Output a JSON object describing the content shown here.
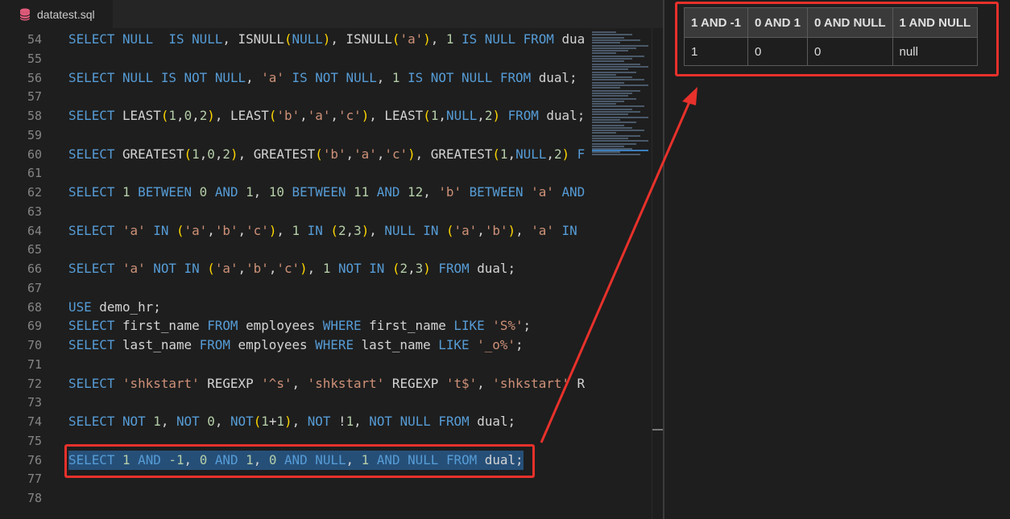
{
  "tab": {
    "title": "datatest.sql",
    "icon": "database-icon"
  },
  "editor": {
    "lines": [
      {
        "n": "54",
        "t": [
          [
            "kw",
            "SELECT "
          ],
          [
            "kw",
            "NULL"
          ],
          [
            "",
            "  "
          ],
          [
            "kw",
            "IS "
          ],
          [
            "kw",
            "NULL"
          ],
          [
            "",
            ", ISNULL"
          ],
          [
            "par",
            "("
          ],
          [
            "kw",
            "NULL"
          ],
          [
            "par",
            ")"
          ],
          [
            "",
            ", ISNULL"
          ],
          [
            "par",
            "("
          ],
          [
            "str",
            "'a'"
          ],
          [
            "par",
            ")"
          ],
          [
            "",
            ", "
          ],
          [
            "num",
            "1 "
          ],
          [
            "kw",
            "IS "
          ],
          [
            "kw",
            "NULL "
          ],
          [
            "kw",
            "FROM "
          ],
          [
            "",
            "dual"
          ]
        ]
      },
      {
        "n": "55",
        "t": []
      },
      {
        "n": "56",
        "t": [
          [
            "kw",
            "SELECT "
          ],
          [
            "kw",
            "NULL "
          ],
          [
            "kw",
            "IS "
          ],
          [
            "kw",
            "NOT "
          ],
          [
            "kw",
            "NULL"
          ],
          [
            "",
            ", "
          ],
          [
            "str",
            "'a' "
          ],
          [
            "kw",
            "IS "
          ],
          [
            "kw",
            "NOT "
          ],
          [
            "kw",
            "NULL"
          ],
          [
            "",
            ", "
          ],
          [
            "num",
            "1 "
          ],
          [
            "kw",
            "IS "
          ],
          [
            "kw",
            "NOT "
          ],
          [
            "kw",
            "NULL "
          ],
          [
            "kw",
            "FROM "
          ],
          [
            "",
            "dual;"
          ]
        ]
      },
      {
        "n": "57",
        "t": []
      },
      {
        "n": "58",
        "t": [
          [
            "kw",
            "SELECT "
          ],
          [
            "",
            "LEAST"
          ],
          [
            "par",
            "("
          ],
          [
            "num",
            "1"
          ],
          [
            "",
            ","
          ],
          [
            "num",
            "0"
          ],
          [
            "",
            ","
          ],
          [
            "num",
            "2"
          ],
          [
            "par",
            ")"
          ],
          [
            "",
            ", LEAST"
          ],
          [
            "par",
            "("
          ],
          [
            "str",
            "'b'"
          ],
          [
            "",
            ","
          ],
          [
            "str",
            "'a'"
          ],
          [
            "",
            ","
          ],
          [
            "str",
            "'c'"
          ],
          [
            "par",
            ")"
          ],
          [
            "",
            ", LEAST"
          ],
          [
            "par",
            "("
          ],
          [
            "num",
            "1"
          ],
          [
            "",
            ","
          ],
          [
            "kw",
            "NULL"
          ],
          [
            "",
            ","
          ],
          [
            "num",
            "2"
          ],
          [
            "par",
            ")"
          ],
          [
            "kw",
            " FROM "
          ],
          [
            "",
            "dual;"
          ]
        ]
      },
      {
        "n": "59",
        "t": []
      },
      {
        "n": "60",
        "t": [
          [
            "kw",
            "SELECT "
          ],
          [
            "",
            "GREATEST"
          ],
          [
            "par",
            "("
          ],
          [
            "num",
            "1"
          ],
          [
            "",
            ","
          ],
          [
            "num",
            "0"
          ],
          [
            "",
            ","
          ],
          [
            "num",
            "2"
          ],
          [
            "par",
            ")"
          ],
          [
            "",
            ", GREATEST"
          ],
          [
            "par",
            "("
          ],
          [
            "str",
            "'b'"
          ],
          [
            "",
            ","
          ],
          [
            "str",
            "'a'"
          ],
          [
            "",
            ","
          ],
          [
            "str",
            "'c'"
          ],
          [
            "par",
            ")"
          ],
          [
            "",
            ", GREATEST"
          ],
          [
            "par",
            "("
          ],
          [
            "num",
            "1"
          ],
          [
            "",
            ","
          ],
          [
            "kw",
            "NULL"
          ],
          [
            "",
            ","
          ],
          [
            "num",
            "2"
          ],
          [
            "par",
            ")"
          ],
          [
            "kw",
            " F"
          ]
        ]
      },
      {
        "n": "61",
        "t": []
      },
      {
        "n": "62",
        "t": [
          [
            "kw",
            "SELECT "
          ],
          [
            "num",
            "1 "
          ],
          [
            "kw",
            "BETWEEN "
          ],
          [
            "num",
            "0 "
          ],
          [
            "kw",
            "AND "
          ],
          [
            "num",
            "1"
          ],
          [
            "",
            ", "
          ],
          [
            "num",
            "10 "
          ],
          [
            "kw",
            "BETWEEN "
          ],
          [
            "num",
            "11 "
          ],
          [
            "kw",
            "AND "
          ],
          [
            "num",
            "12"
          ],
          [
            "",
            ", "
          ],
          [
            "str",
            "'b' "
          ],
          [
            "kw",
            "BETWEEN "
          ],
          [
            "str",
            "'a' "
          ],
          [
            "kw",
            "AND"
          ]
        ]
      },
      {
        "n": "63",
        "t": []
      },
      {
        "n": "64",
        "t": [
          [
            "kw",
            "SELECT "
          ],
          [
            "str",
            "'a' "
          ],
          [
            "kw",
            "IN "
          ],
          [
            "par",
            "("
          ],
          [
            "str",
            "'a'"
          ],
          [
            "",
            ","
          ],
          [
            "str",
            "'b'"
          ],
          [
            "",
            ","
          ],
          [
            "str",
            "'c'"
          ],
          [
            "par",
            ")"
          ],
          [
            "",
            ", "
          ],
          [
            "num",
            "1 "
          ],
          [
            "kw",
            "IN "
          ],
          [
            "par",
            "("
          ],
          [
            "num",
            "2"
          ],
          [
            "",
            ","
          ],
          [
            "num",
            "3"
          ],
          [
            "par",
            ")"
          ],
          [
            "",
            ", "
          ],
          [
            "kw",
            "NULL "
          ],
          [
            "kw",
            "IN "
          ],
          [
            "par",
            "("
          ],
          [
            "str",
            "'a'"
          ],
          [
            "",
            ","
          ],
          [
            "str",
            "'b'"
          ],
          [
            "par",
            ")"
          ],
          [
            "",
            ", "
          ],
          [
            "str",
            "'a' "
          ],
          [
            "kw",
            "IN"
          ]
        ]
      },
      {
        "n": "65",
        "t": []
      },
      {
        "n": "66",
        "t": [
          [
            "kw",
            "SELECT "
          ],
          [
            "str",
            "'a' "
          ],
          [
            "kw",
            "NOT "
          ],
          [
            "kw",
            "IN "
          ],
          [
            "par",
            "("
          ],
          [
            "str",
            "'a'"
          ],
          [
            "",
            ","
          ],
          [
            "str",
            "'b'"
          ],
          [
            "",
            ","
          ],
          [
            "str",
            "'c'"
          ],
          [
            "par",
            ")"
          ],
          [
            "",
            ", "
          ],
          [
            "num",
            "1 "
          ],
          [
            "kw",
            "NOT "
          ],
          [
            "kw",
            "IN "
          ],
          [
            "par",
            "("
          ],
          [
            "num",
            "2"
          ],
          [
            "",
            ","
          ],
          [
            "num",
            "3"
          ],
          [
            "par",
            ")"
          ],
          [
            "kw",
            " FROM "
          ],
          [
            "",
            "dual;"
          ]
        ]
      },
      {
        "n": "67",
        "t": []
      },
      {
        "n": "68",
        "t": [
          [
            "kw",
            "USE "
          ],
          [
            "",
            "demo_hr;"
          ]
        ]
      },
      {
        "n": "69",
        "t": [
          [
            "kw",
            "SELECT "
          ],
          [
            "",
            "first_name "
          ],
          [
            "kw",
            "FROM "
          ],
          [
            "",
            "employees "
          ],
          [
            "kw",
            "WHERE "
          ],
          [
            "",
            "first_name "
          ],
          [
            "kw",
            "LIKE "
          ],
          [
            "str",
            "'S%'"
          ],
          [
            "",
            ";"
          ]
        ]
      },
      {
        "n": "70",
        "t": [
          [
            "kw",
            "SELECT "
          ],
          [
            "",
            "last_name "
          ],
          [
            "kw",
            "FROM "
          ],
          [
            "",
            "employees "
          ],
          [
            "kw",
            "WHERE "
          ],
          [
            "",
            "last_name "
          ],
          [
            "kw",
            "LIKE "
          ],
          [
            "str",
            "'_o%'"
          ],
          [
            "",
            ";"
          ]
        ]
      },
      {
        "n": "71",
        "t": []
      },
      {
        "n": "72",
        "t": [
          [
            "kw",
            "SELECT "
          ],
          [
            "str",
            "'shkstart' "
          ],
          [
            "",
            "REGEXP "
          ],
          [
            "str",
            "'^s'"
          ],
          [
            "",
            ", "
          ],
          [
            "str",
            "'shkstart' "
          ],
          [
            "",
            "REGEXP "
          ],
          [
            "str",
            "'t$'"
          ],
          [
            "",
            ", "
          ],
          [
            "str",
            "'shkstart' "
          ],
          [
            "",
            "R"
          ]
        ]
      },
      {
        "n": "73",
        "t": []
      },
      {
        "n": "74",
        "t": [
          [
            "kw",
            "SELECT "
          ],
          [
            "kw",
            "NOT "
          ],
          [
            "num",
            "1"
          ],
          [
            "",
            ", "
          ],
          [
            "kw",
            "NOT "
          ],
          [
            "num",
            "0"
          ],
          [
            "",
            ", "
          ],
          [
            "kw",
            "NOT"
          ],
          [
            "par",
            "("
          ],
          [
            "num",
            "1"
          ],
          [
            "",
            "+"
          ],
          [
            "num",
            "1"
          ],
          [
            "par",
            ")"
          ],
          [
            "",
            ", "
          ],
          [
            "kw",
            "NOT "
          ],
          [
            "",
            "!"
          ],
          [
            "num",
            "1"
          ],
          [
            "",
            ", "
          ],
          [
            "kw",
            "NOT "
          ],
          [
            "kw",
            "NULL "
          ],
          [
            "kw",
            "FROM "
          ],
          [
            "",
            "dual;"
          ]
        ]
      },
      {
        "n": "75",
        "t": []
      },
      {
        "n": "76",
        "sel": true,
        "t": [
          [
            "kw",
            "SELECT "
          ],
          [
            "num",
            "1 "
          ],
          [
            "kw",
            "AND "
          ],
          [
            "num",
            "-1"
          ],
          [
            "",
            ", "
          ],
          [
            "num",
            "0 "
          ],
          [
            "kw",
            "AND "
          ],
          [
            "num",
            "1"
          ],
          [
            "",
            ", "
          ],
          [
            "num",
            "0 "
          ],
          [
            "kw",
            "AND "
          ],
          [
            "kw",
            "NULL"
          ],
          [
            "",
            ", "
          ],
          [
            "num",
            "1 "
          ],
          [
            "kw",
            "AND "
          ],
          [
            "kw",
            "NULL "
          ],
          [
            "kw",
            "FROM "
          ],
          [
            "",
            "dual;"
          ]
        ]
      },
      {
        "n": "77",
        "t": []
      },
      {
        "n": "78",
        "t": []
      }
    ]
  },
  "result": {
    "headers": [
      "1 AND -1",
      "0 AND 1",
      "0 AND NULL",
      "1 AND NULL"
    ],
    "row": [
      "1",
      "0",
      "0",
      "null"
    ]
  },
  "colors": {
    "highlight": "#e8312b",
    "keyword": "#569cd6",
    "string": "#ce9178"
  }
}
